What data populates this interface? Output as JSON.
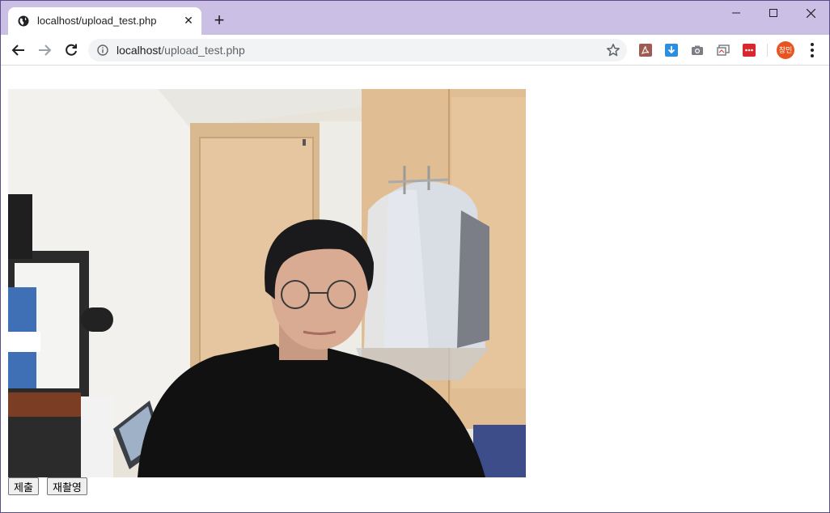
{
  "browser": {
    "tab": {
      "title": "localhost/upload_test.php",
      "favicon": "globe-icon",
      "close_icon": "close-icon"
    },
    "new_tab_icon": "plus-icon",
    "window_controls": [
      "minimize-icon",
      "maximize-icon",
      "close-icon"
    ],
    "address_bar": {
      "host": "localhost",
      "path": "/upload_test.php",
      "info_icon": "info-icon",
      "bookmark_icon": "star-icon"
    },
    "extensions": [
      "pdf-icon",
      "download-icon",
      "camera-icon",
      "cast-icon",
      "more-extension-icon"
    ],
    "profile": {
      "initials": "창민",
      "color": "#e8541f"
    },
    "colors": {
      "frame": "#cbbfe6",
      "toolbar": "#ffffff",
      "omnibox": "#f1f3f4"
    }
  },
  "page": {
    "captured_image_alt": "webcam capture",
    "buttons": {
      "submit": "제출",
      "retake": "재촬영"
    }
  }
}
